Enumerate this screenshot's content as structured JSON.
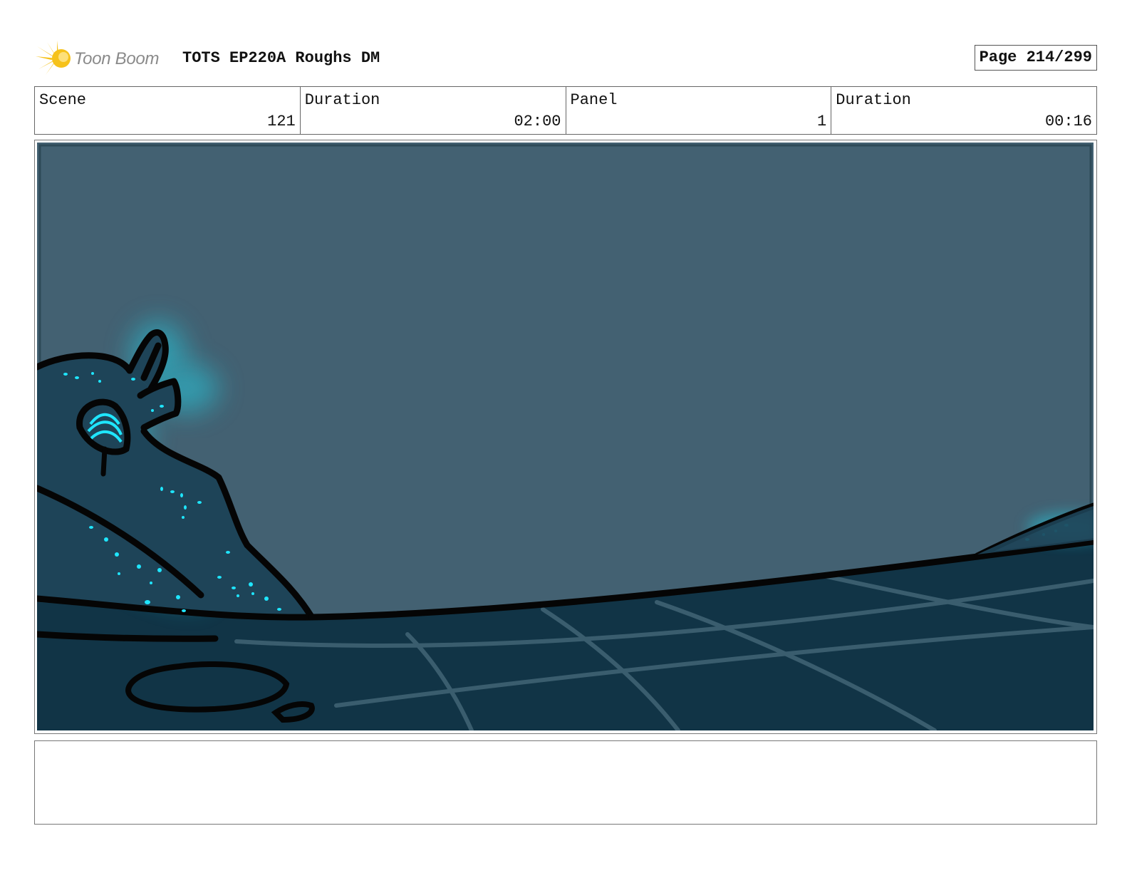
{
  "header": {
    "logo_text": "Toon Boom",
    "title": "TOTS EP220A Roughs DM",
    "page_label": "Page 214/299"
  },
  "info": {
    "scene_label": "Scene",
    "scene_value": "121",
    "scene_duration_label": "Duration",
    "scene_duration_value": "02:00",
    "panel_label": "Panel",
    "panel_value": "1",
    "panel_duration_label": "Duration",
    "panel_duration_value": "00:16"
  },
  "panel": {
    "colors": {
      "sky": "#436172",
      "ground": "#113446",
      "creature": "#1e4458",
      "glow": "#28c8dc",
      "spots": "#1fe6ff",
      "outline": "#050505",
      "ground_lines": "#3a5d6e"
    }
  },
  "notes": {
    "text": ""
  }
}
